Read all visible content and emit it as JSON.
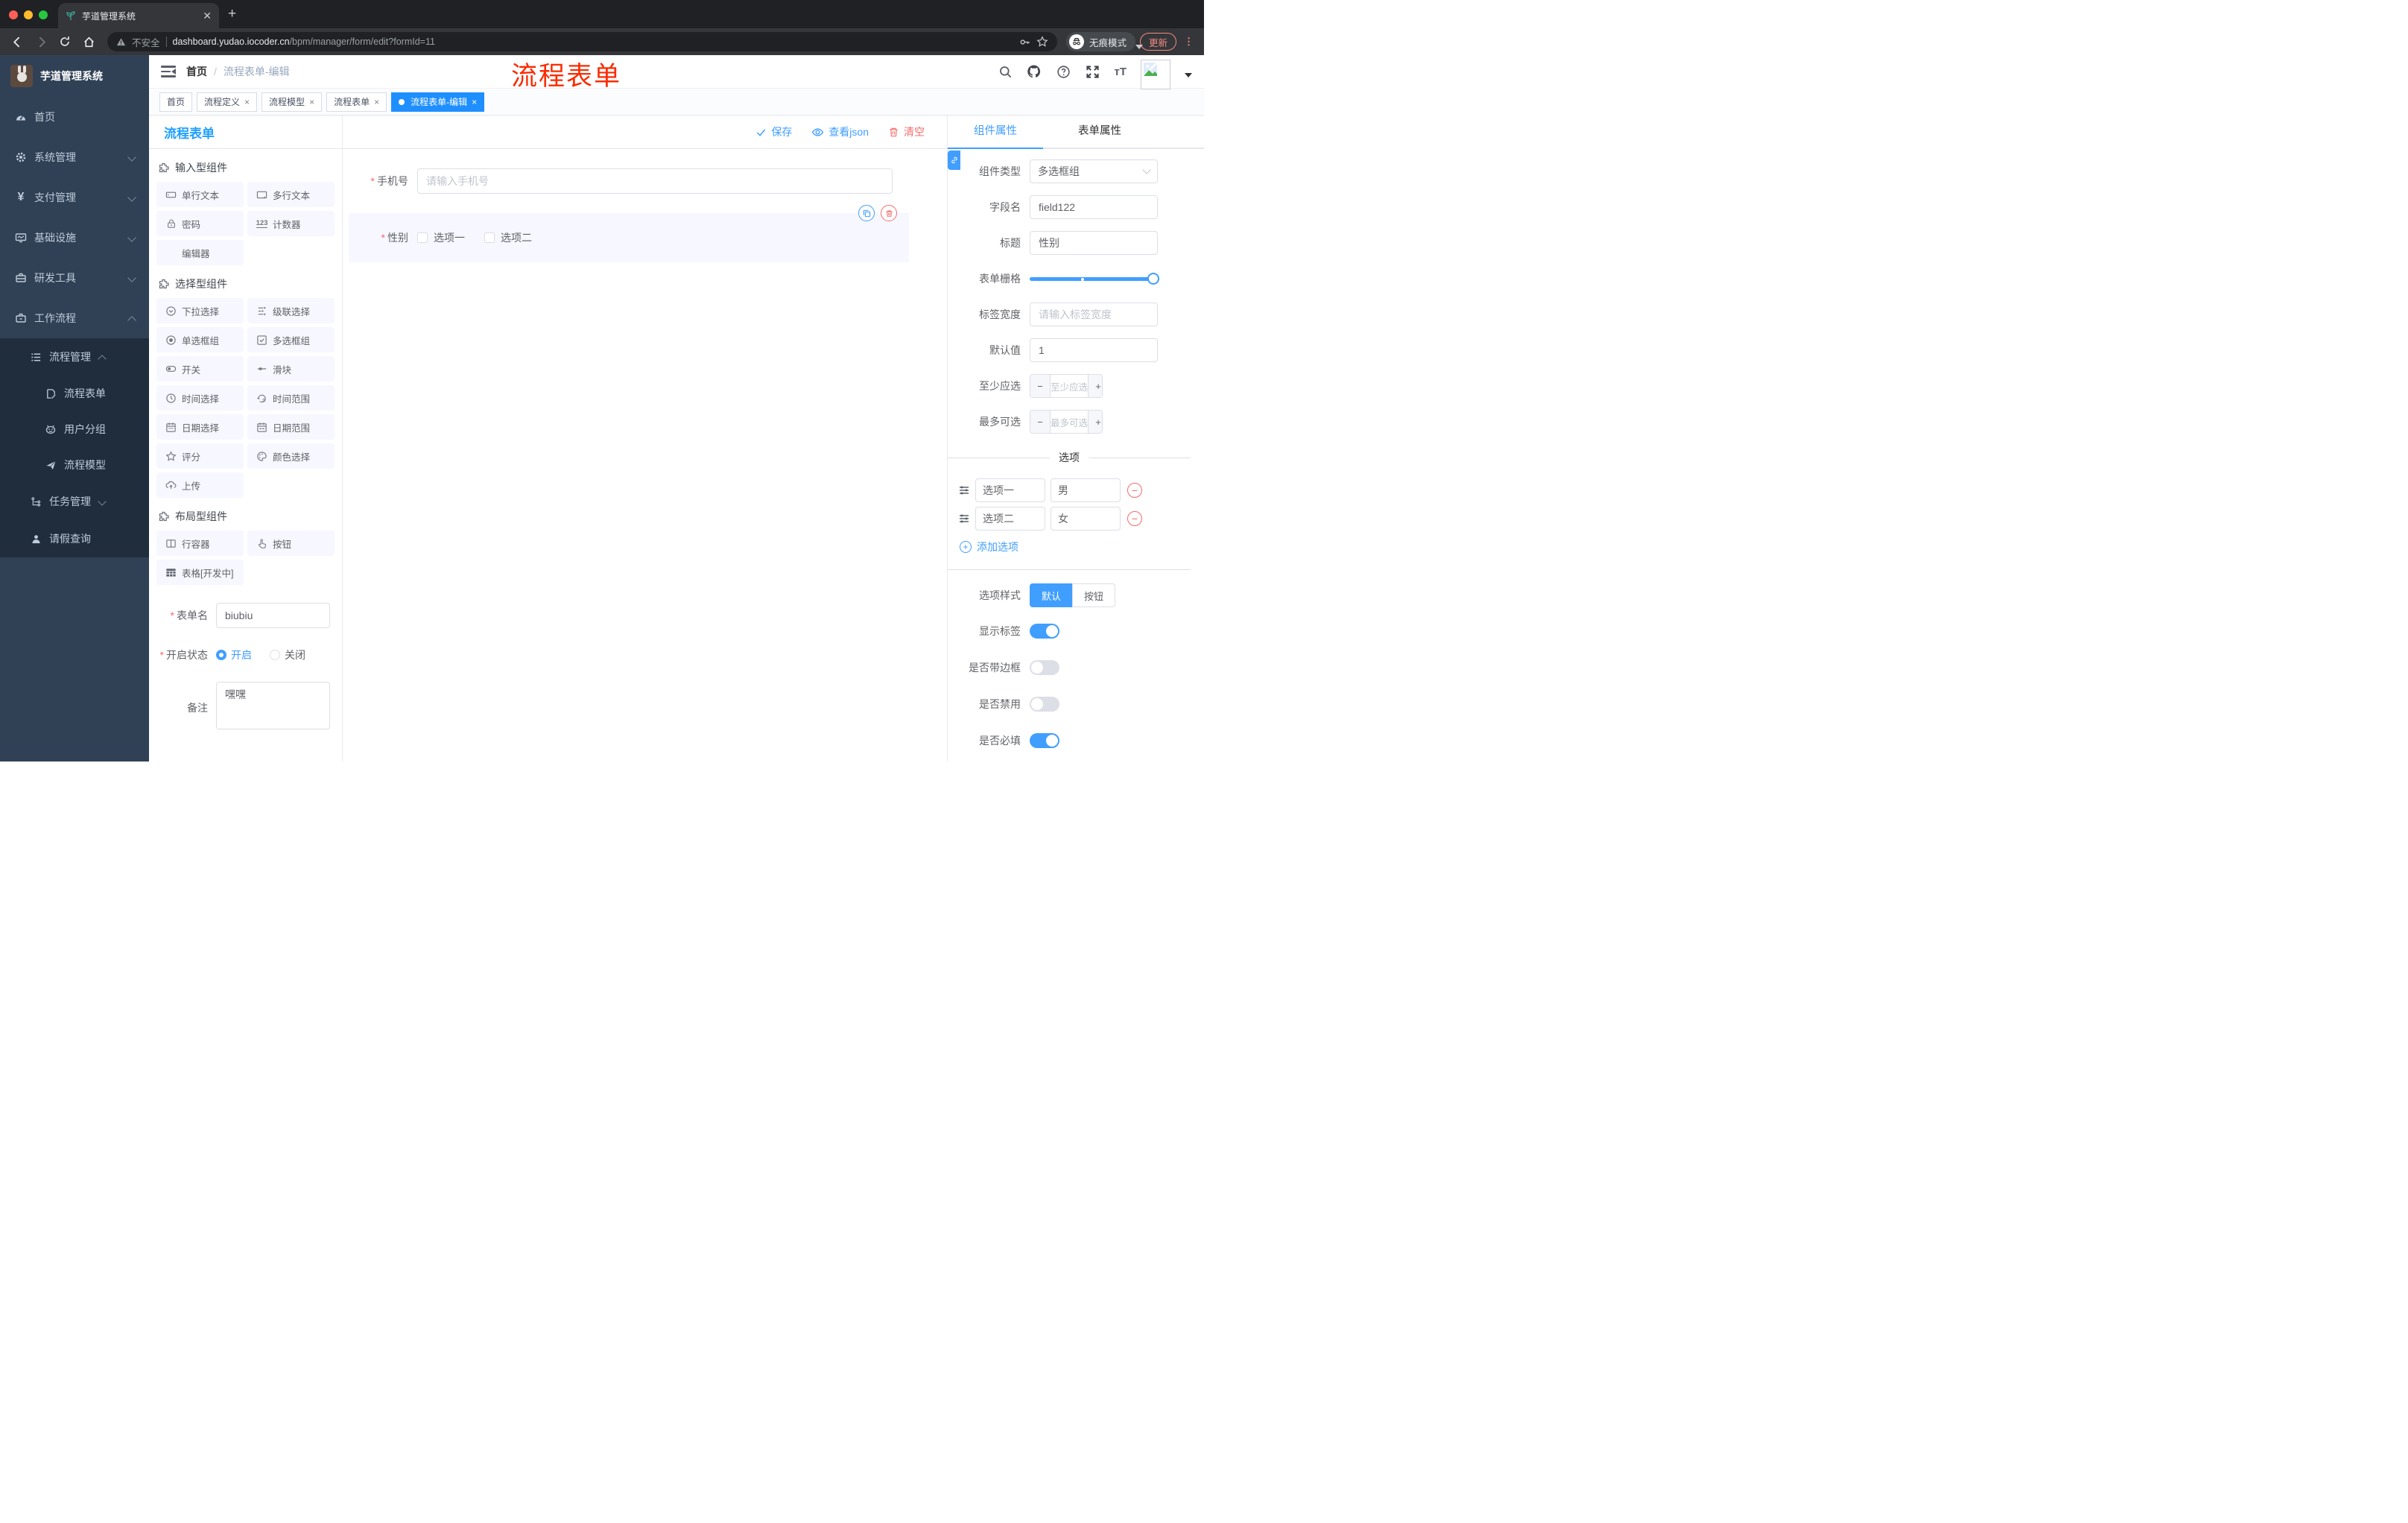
{
  "chrome": {
    "tab_title": "芋道管理系统",
    "security_label": "不安全",
    "url_host": "dashboard.yudao.iocoder.cn",
    "url_path": "/bpm/manager/form/edit?formId=11",
    "incognito_label": "无痕模式",
    "update_label": "更新"
  },
  "sidebar": {
    "logo_title": "芋道管理系统",
    "menu": [
      {
        "label": "首页"
      },
      {
        "label": "系统管理"
      },
      {
        "label": "支付管理"
      },
      {
        "label": "基础设施"
      },
      {
        "label": "研发工具"
      },
      {
        "label": "工作流程"
      }
    ],
    "submenu": {
      "group_label": "流程管理",
      "group_children": [
        "流程表单",
        "用户分组",
        "流程模型"
      ],
      "tasks_label": "任务管理",
      "leave_label": "请假查询"
    }
  },
  "header": {
    "breadcrumb_home": "首页",
    "breadcrumb_sep": "/",
    "breadcrumb_current": "流程表单-编辑",
    "annotation": "流程表单"
  },
  "tags": [
    {
      "label": "首页"
    },
    {
      "label": "流程定义"
    },
    {
      "label": "流程模型"
    },
    {
      "label": "流程表单"
    },
    {
      "label": "流程表单-编辑"
    }
  ],
  "palette": {
    "title": "流程表单",
    "sections": [
      {
        "title": "输入型组件",
        "items": [
          "单行文本",
          "多行文本",
          "密码",
          "计数器",
          "编辑器"
        ]
      },
      {
        "title": "选择型组件",
        "items": [
          "下拉选择",
          "级联选择",
          "单选框组",
          "多选框组",
          "开关",
          "滑块",
          "时间选择",
          "时间范围",
          "日期选择",
          "日期范围",
          "评分",
          "颜色选择",
          "上传"
        ]
      },
      {
        "title": "布局型组件",
        "items": [
          "行容器",
          "按钮",
          "表格[开发中]"
        ]
      }
    ],
    "form": {
      "required_mark": "*",
      "name_label": "表单名",
      "name_value": "biubiu",
      "status_label": "开启状态",
      "status_on": "开启",
      "status_off": "关闭",
      "remark_label": "备注",
      "remark_value": "嘿嘿"
    }
  },
  "canvas": {
    "save_label": "保存",
    "view_json_label": "查看json",
    "clear_label": "清空",
    "phone": {
      "label": "手机号",
      "placeholder": "请输入手机号"
    },
    "gender": {
      "label": "性别",
      "option1": "选项一",
      "option2": "选项二"
    }
  },
  "panel": {
    "tab_component": "组件属性",
    "tab_form": "表单属性",
    "fields": {
      "type_label": "组件类型",
      "type_value": "多选框组",
      "name_label": "字段名",
      "name_value": "field122",
      "title_label": "标题",
      "title_value": "性别",
      "grid_label": "表单栅格",
      "width_label": "标签宽度",
      "width_placeholder": "请输入标签宽度",
      "default_label": "默认值",
      "default_value": "1",
      "min_label": "至少应选",
      "min_placeholder": "至少应选",
      "max_label": "最多可选",
      "max_placeholder": "最多可选"
    },
    "options": {
      "divider_label": "选项",
      "rows": [
        {
          "label": "选项一",
          "value": "男"
        },
        {
          "label": "选项二",
          "value": "女"
        }
      ],
      "add_label": "添加选项"
    },
    "style": {
      "label": "选项样式",
      "opt_default": "默认",
      "opt_button": "按钮"
    },
    "switches": [
      {
        "label": "显示标签",
        "on": true
      },
      {
        "label": "是否带边框",
        "on": false
      },
      {
        "label": "是否禁用",
        "on": false
      },
      {
        "label": "是否必填",
        "on": true
      }
    ]
  },
  "colors": {
    "accent": "#409eff",
    "danger": "#f56c6c",
    "sidebar": "#304156",
    "sidebar_sub": "#1f2d3d",
    "active_tag": "#1f8fff",
    "annotation_red": "#fb2b01"
  }
}
